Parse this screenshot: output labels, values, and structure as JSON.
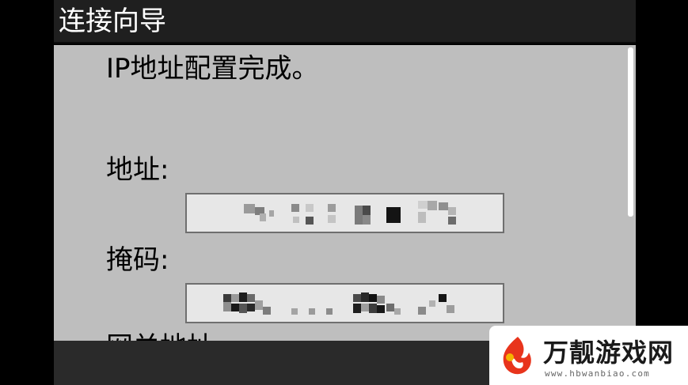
{
  "window": {
    "title": "连接向导"
  },
  "content": {
    "message": "IP地址配置完成。",
    "address_label": "地址:",
    "mask_label": "掩码:",
    "gateway_label": "网关地址"
  },
  "colors": {
    "title_bar": "#1f1f1f",
    "content_bg": "#bebebe",
    "field_bg": "#e7e7e7",
    "scroll_thumb": "#ffffff",
    "watermark_accent": "#e8341c"
  },
  "icons": {
    "watermark_logo": "flame-leaf-logo-icon"
  },
  "watermark": {
    "name": "万靓游戏网",
    "url": "www.hbwanbiao.com"
  }
}
